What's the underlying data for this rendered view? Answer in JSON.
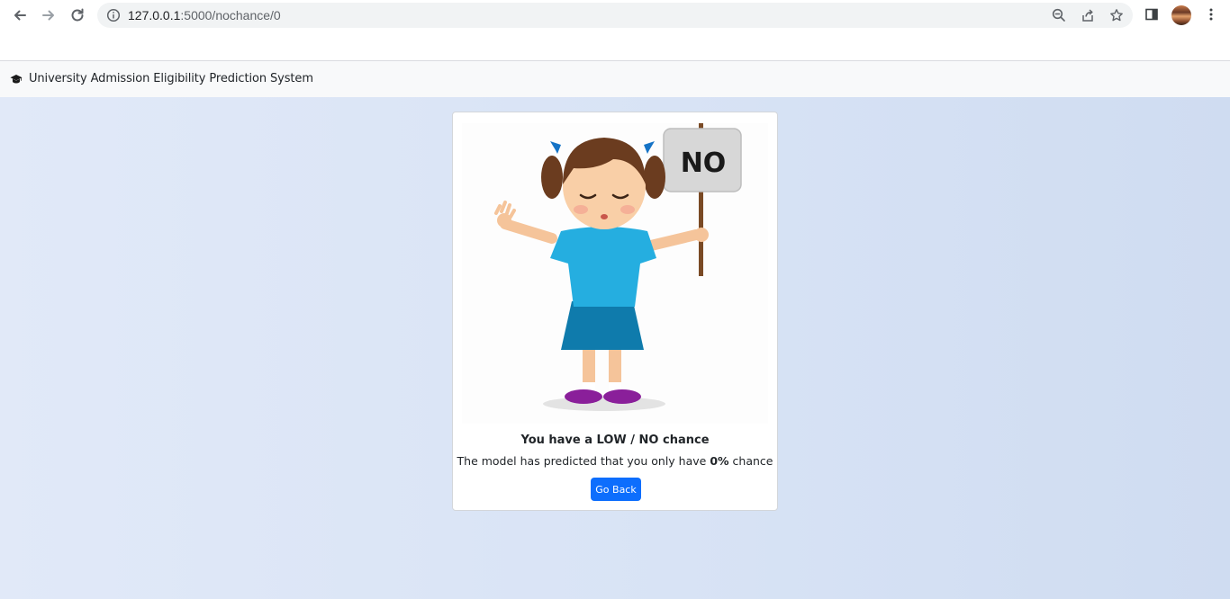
{
  "browser": {
    "url_host": "127.0.0.1",
    "url_path": ":5000/nochance/0",
    "icons": [
      "back-icon",
      "forward-icon",
      "reload-icon",
      "info-icon",
      "zoom-icon",
      "share-icon",
      "star-icon",
      "side-panel-icon",
      "profile-avatar",
      "kebab-menu-icon"
    ]
  },
  "navbar": {
    "brand": "University Admission Eligibility Prediction System",
    "brand_icon": "graduation-cap-icon"
  },
  "result_card": {
    "sign_text": "NO",
    "title": "You have a LOW / NO chance",
    "text_before": "The model has predicted that you only have ",
    "percent": "0%",
    "text_after": " chance",
    "button_label": "Go Back"
  },
  "colors": {
    "button": "#0d6efd",
    "page_bg": "#dbe5f6",
    "navbar_bg": "#f8f9fa"
  }
}
